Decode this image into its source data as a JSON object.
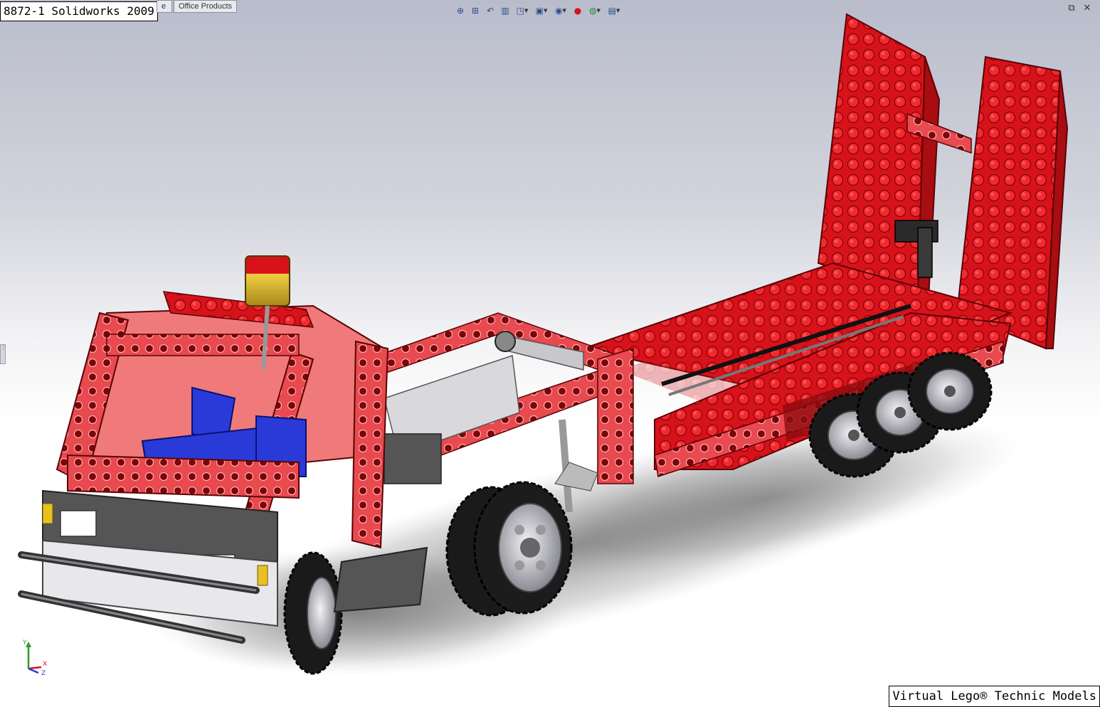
{
  "app": {
    "title_overlay": "8872-1 Solidworks 2009",
    "footer_overlay": "Virtual Lego® Technic Models"
  },
  "tabs": [
    {
      "label": "e"
    },
    {
      "label": "Office Products"
    }
  ],
  "view_toolbar": {
    "buttons": [
      {
        "icon": "zoom-to-fit-icon",
        "glyph": "⊕"
      },
      {
        "icon": "zoom-to-area-icon",
        "glyph": "⊞"
      },
      {
        "icon": "previous-view-icon",
        "glyph": "↶"
      },
      {
        "icon": "section-view-icon",
        "glyph": "▥"
      },
      {
        "icon": "view-orientation-icon",
        "glyph": "◳"
      },
      {
        "icon": "display-style-icon",
        "glyph": "▣"
      },
      {
        "icon": "hide-show-items-icon",
        "glyph": "◉"
      },
      {
        "icon": "edit-appearance-icon",
        "glyph": "●"
      },
      {
        "icon": "apply-scene-icon",
        "glyph": "◍"
      },
      {
        "icon": "view-settings-icon",
        "glyph": "▤"
      }
    ]
  },
  "window_controls": {
    "restore_glyph": "⧉",
    "close_glyph": "✕"
  },
  "triad": {
    "x_label": "X",
    "y_label": "Y",
    "z_label": "Z"
  },
  "colors": {
    "brick_red": "#d8121a",
    "brick_red_dark": "#8e0b10",
    "beam_pink": "#f07a7a",
    "seat_blue": "#2a3ad8",
    "tire_black": "#1a1a1a",
    "rim_gray": "#b8b8c0",
    "light_gray": "#d9d9dd",
    "warning_amber": "#e8c020"
  }
}
